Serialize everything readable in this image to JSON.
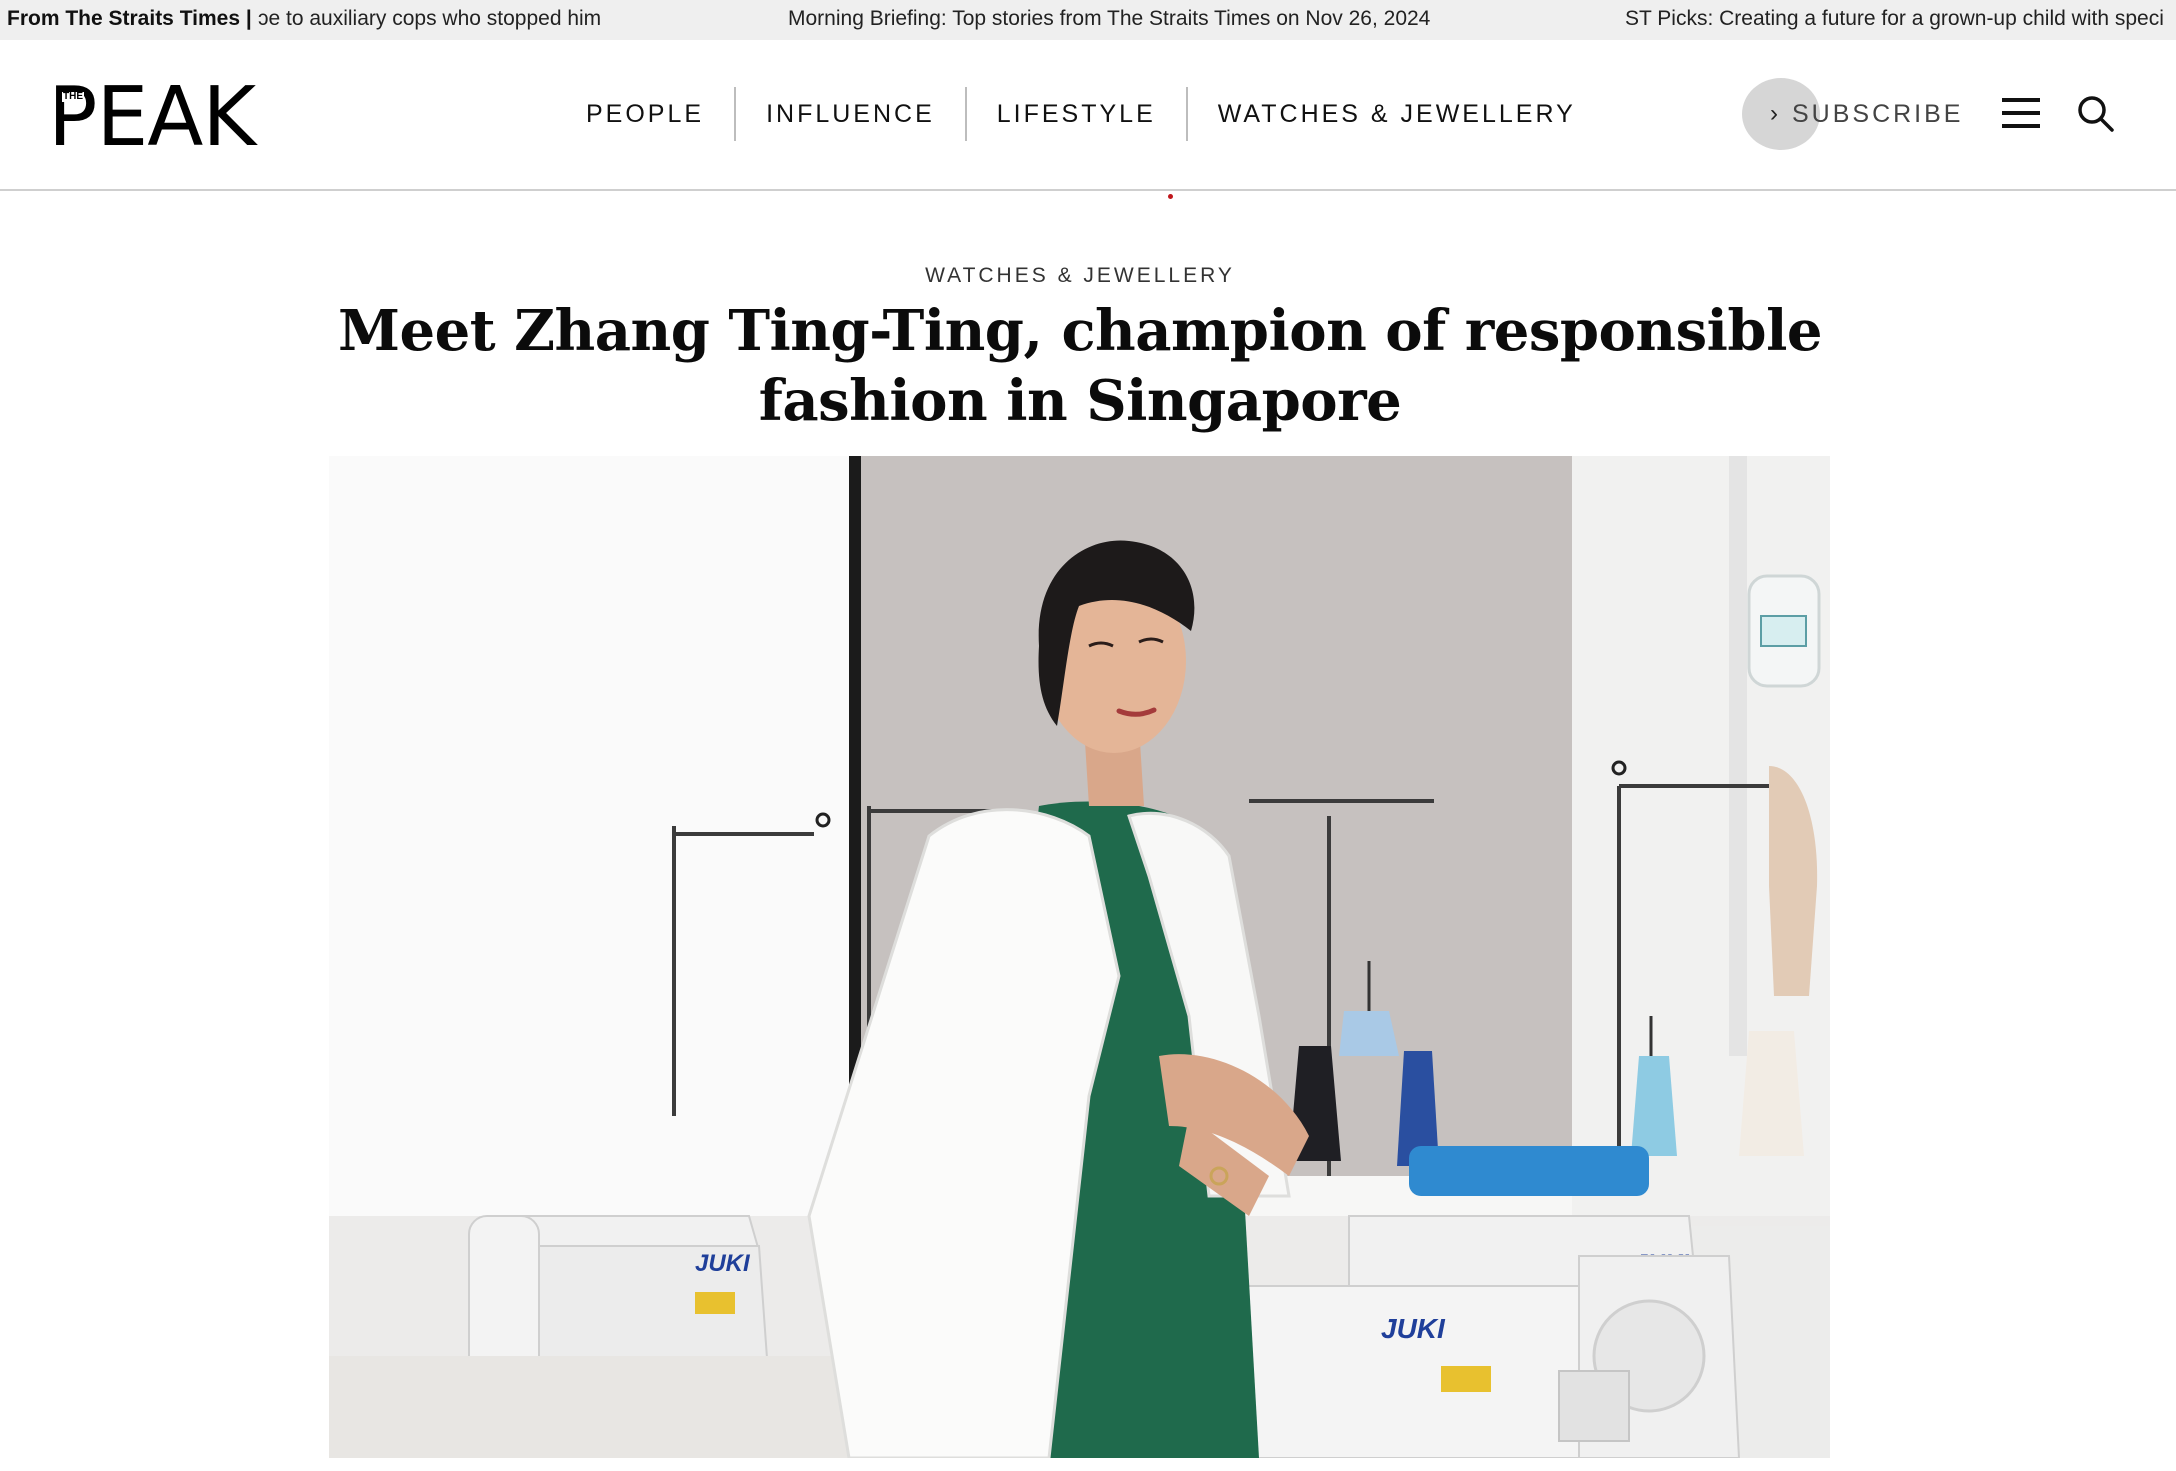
{
  "ticker": {
    "source": "From The Straits Times |",
    "items": [
      "ɔe to auxiliary cops who stopped him",
      "Morning Briefing: Top stories from The Straits Times on Nov 26, 2024",
      "ST Picks: Creating a future for a grown-up child with speci"
    ]
  },
  "header": {
    "logo_the": "THE",
    "logo_word": "PEAK",
    "nav": [
      "PEOPLE",
      "INFLUENCE",
      "LIFESTYLE",
      "WATCHES & JEWELLERY"
    ],
    "subscribe_label": "SUBSCRIBE",
    "icons": {
      "subscribe": "chevron-right-icon",
      "menu": "hamburger-menu-icon",
      "search": "search-icon"
    }
  },
  "article": {
    "category": "WATCHES & JEWELLERY",
    "title": "Meet Zhang Ting-Ting, champion of responsible fashion in Singapore",
    "hero_image": {
      "machine_brand_a": "JUKI",
      "machine_brand_b": "JUKI",
      "machine_brand_c": "JUKI"
    }
  },
  "colors": {
    "accent_dot": "#c0161c",
    "ticker_bg": "#efefef",
    "dress_green": "#1f6a4c"
  }
}
